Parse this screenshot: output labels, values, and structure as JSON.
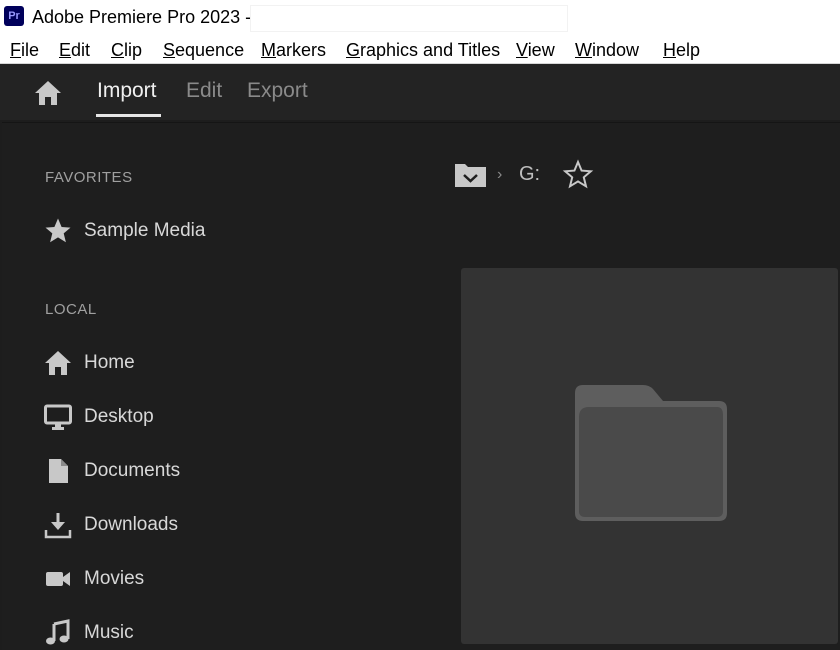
{
  "window": {
    "title": "Adobe Premiere Pro 2023 -",
    "app_badge": "Pr"
  },
  "menu": {
    "items": [
      {
        "label": "File"
      },
      {
        "label": "Edit"
      },
      {
        "label": "Clip"
      },
      {
        "label": "Sequence"
      },
      {
        "label": "Markers"
      },
      {
        "label": "Graphics and Titles"
      },
      {
        "label": "View"
      },
      {
        "label": "Window"
      },
      {
        "label": "Help"
      }
    ]
  },
  "header": {
    "tabs": [
      {
        "label": "Import",
        "active": true
      },
      {
        "label": "Edit",
        "active": false
      },
      {
        "label": "Export",
        "active": false
      }
    ],
    "home_icon": "home-icon"
  },
  "sidebar": {
    "favorites_heading": "FAVORITES",
    "favorites": [
      {
        "label": "Sample Media",
        "icon": "star-icon"
      }
    ],
    "local_heading": "LOCAL",
    "local": [
      {
        "label": "Home",
        "icon": "home-icon"
      },
      {
        "label": "Desktop",
        "icon": "monitor-icon"
      },
      {
        "label": "Documents",
        "icon": "document-icon"
      },
      {
        "label": "Downloads",
        "icon": "download-icon"
      },
      {
        "label": "Movies",
        "icon": "video-camera-icon"
      },
      {
        "label": "Music",
        "icon": "music-note-icon"
      }
    ]
  },
  "location": {
    "path": "G:",
    "separator": "›"
  },
  "colors": {
    "background": "#1e1e1e",
    "header": "#232323",
    "preview": "#333333",
    "folder": "#4a4a4a",
    "text": "#d8d8d8"
  }
}
